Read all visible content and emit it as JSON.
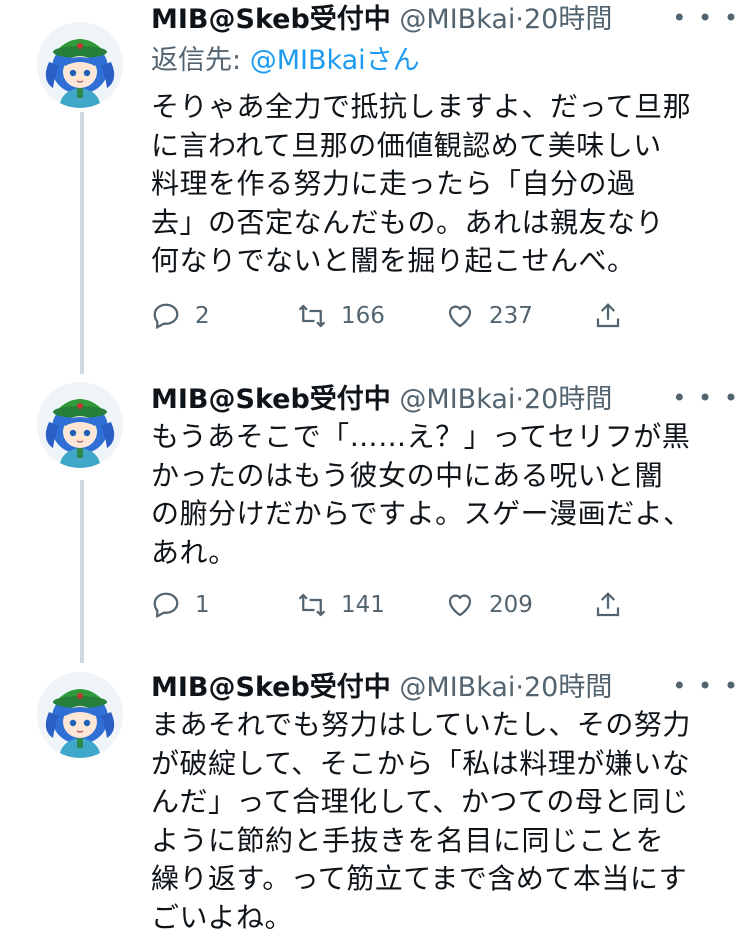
{
  "tweets": [
    {
      "name": "MIB@Skeb受付中",
      "handle": "@MIBkai",
      "separator": "·",
      "time": "20時間",
      "reply_prefix": "返信先: ",
      "reply_mention": "@MIBkai",
      "reply_suffix": "さん",
      "text": "そりゃあ全力で抵抗しますよ、だって旦那\nに言われて旦那の価値観認めて美味しい\n料理を作る努力に走ったら「自分の過\n去」の否定なんだもの。あれは親友なり\n何なりでないと闇を掘り起こせんべ。",
      "replies": "2",
      "retweets": "166",
      "likes": "237"
    },
    {
      "name": "MIB@Skeb受付中",
      "handle": "@MIBkai",
      "separator": "·",
      "time": "20時間",
      "text": "もうあそこで「……え？」ってセリフが黒\nかったのはもう彼女の中にある呪いと闇\nの腑分けだからですよ。スゲー漫画だよ、\nあれ。",
      "replies": "1",
      "retweets": "141",
      "likes": "209"
    },
    {
      "name": "MIB@Skeb受付中",
      "handle": "@MIBkai",
      "separator": "·",
      "time": "20時間",
      "text": "まあそれでも努力はしていたし、その努力\nが破綻して、そこから「私は料理が嫌いな\nんだ」って合理化して、かつての母と同じ\nように節約と手抜きを名目に同じことを\n繰り返す。って筋立てまで含めて本当にす\nごいよね。"
    }
  ],
  "icons": {
    "reply": "reply-icon",
    "retweet": "retweet-icon",
    "like": "heart-icon",
    "share": "share-icon",
    "more": "more-icon"
  },
  "colors": {
    "secondary": "#536471",
    "link": "#1d9bf0",
    "thread_line": "#cfd9de"
  }
}
